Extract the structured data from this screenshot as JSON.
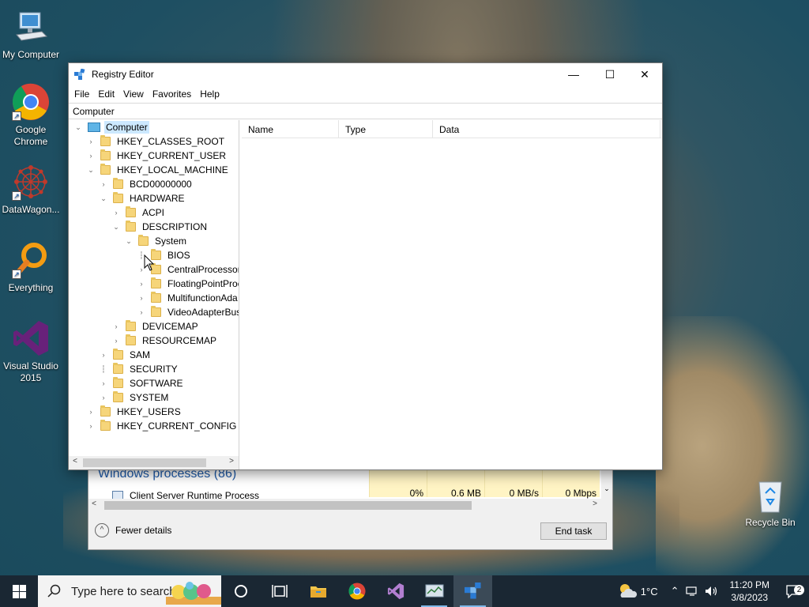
{
  "desktop": {
    "icons": [
      {
        "label": "My Computer"
      },
      {
        "label": "Google Chrome"
      },
      {
        "label": "DataWagon..."
      },
      {
        "label": "Everything"
      },
      {
        "label": "Visual Studio 2015"
      },
      {
        "label": "Recycle Bin"
      }
    ]
  },
  "taskmgr": {
    "processes_heading": "Windows processes (86)",
    "row": {
      "name": "Client Server Runtime Process",
      "cpu": "0%",
      "memory": "0.6 MB",
      "disk": "0 MB/s",
      "network": "0 Mbps"
    },
    "fewer_details": "Fewer details",
    "end_task": "End task"
  },
  "regedit": {
    "title": "Registry Editor",
    "menu": [
      "File",
      "Edit",
      "View",
      "Favorites",
      "Help"
    ],
    "address": "Computer",
    "tree": [
      {
        "label": "Computer"
      },
      {
        "label": "HKEY_CLASSES_ROOT"
      },
      {
        "label": "HKEY_CURRENT_USER"
      },
      {
        "label": "HKEY_LOCAL_MACHINE"
      },
      {
        "label": "BCD00000000"
      },
      {
        "label": "HARDWARE"
      },
      {
        "label": "ACPI"
      },
      {
        "label": "DESCRIPTION"
      },
      {
        "label": "System"
      },
      {
        "label": "BIOS"
      },
      {
        "label": "CentralProcessor"
      },
      {
        "label": "FloatingPointProc"
      },
      {
        "label": "MultifunctionAda"
      },
      {
        "label": "VideoAdapterBus"
      },
      {
        "label": "DEVICEMAP"
      },
      {
        "label": "RESOURCEMAP"
      },
      {
        "label": "SAM"
      },
      {
        "label": "SECURITY"
      },
      {
        "label": "SOFTWARE"
      },
      {
        "label": "SYSTEM"
      },
      {
        "label": "HKEY_USERS"
      },
      {
        "label": "HKEY_CURRENT_CONFIG"
      }
    ],
    "columns": [
      "Name",
      "Type",
      "Data"
    ]
  },
  "taskbar": {
    "search_placeholder": "Type here to search",
    "weather": "1°C",
    "time": "11:20 PM",
    "date": "3/8/2023",
    "notifications_count": "2"
  },
  "colors": {
    "taskbar_bg": "#1a2733",
    "selection": "#cce8ff",
    "folder": "#f6d57a"
  }
}
